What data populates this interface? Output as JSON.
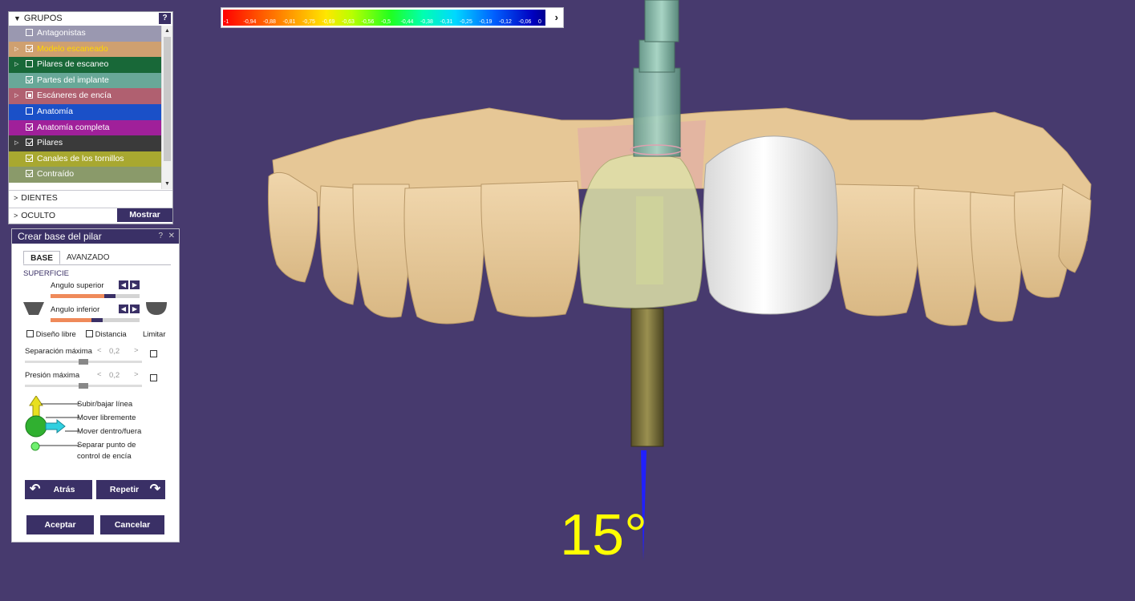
{
  "groups_panel": {
    "title": "GRUPOS",
    "help": "?",
    "items": [
      {
        "label": "Antagonistas",
        "checked": false,
        "expand": false,
        "color": "#9a98b0",
        "text_color": "#ffffff"
      },
      {
        "label": "Modelo escaneado",
        "checked": true,
        "expand": true,
        "color": "#cfa070",
        "text_color": "#ffd700"
      },
      {
        "label": "Pilares de escaneo",
        "checked": false,
        "expand": true,
        "color": "#186838",
        "text_color": "#ffffff"
      },
      {
        "label": "Partes del implante",
        "checked": true,
        "expand": false,
        "color": "#68a898",
        "text_color": "#ffffff"
      },
      {
        "label": "Escáneres de encía",
        "checked": "partial",
        "expand": true,
        "color": "#b06070",
        "text_color": "#ffffff"
      },
      {
        "label": "Anatomía",
        "checked": false,
        "expand": false,
        "color": "#1a50c8",
        "text_color": "#ffffff"
      },
      {
        "label": "Anatomía completa",
        "checked": true,
        "expand": false,
        "color": "#a0209a",
        "text_color": "#ffffff"
      },
      {
        "label": "Pilares",
        "checked": true,
        "expand": true,
        "color": "#3a3a3a",
        "text_color": "#ffffff"
      },
      {
        "label": "Canales de los tornillos",
        "checked": true,
        "expand": false,
        "color": "#a8a830",
        "text_color": "#ffffff"
      },
      {
        "label": "Contraído",
        "checked": true,
        "expand": false,
        "color": "#8a9a6a",
        "text_color": "#ffffff"
      }
    ],
    "sections": {
      "dientes": "DIENTES",
      "oculto": "OCULTO",
      "mostrar": "Mostrar"
    }
  },
  "base_panel": {
    "title": "Crear base del pilar",
    "help": "?",
    "close": "✕",
    "tabs": [
      "BASE",
      "AVANZADO"
    ],
    "section": "SUPERFICIE",
    "angulo_superior": {
      "label": "Angulo superior",
      "level": 0.6
    },
    "angulo_inferior": {
      "label": "Angulo inferior",
      "level": 0.46
    },
    "diseno_libre": "Diseño libre",
    "distancia": "Distancia",
    "limitar": "Limitar",
    "separacion": {
      "label": "Separación máxima",
      "value": "0,2",
      "level": 0.46
    },
    "presion": {
      "label": "Presión máxima",
      "value": "0,2",
      "level": 0.46
    },
    "legend": {
      "subir": "Subir/bajar línea",
      "mover_libre": "Mover libremente",
      "mover_dentro": "Mover dentro/fuera",
      "separar_1": "Separar punto de",
      "separar_2": "control de encía"
    },
    "buttons": {
      "atras": "Atrás",
      "repetir": "Repetir",
      "aceptar": "Aceptar",
      "cancelar": "Cancelar"
    }
  },
  "color_scale": {
    "ticks": [
      "-1",
      "-0,94",
      "-0,88",
      "-0,81",
      "-0,75",
      "-0,69",
      "-0,63",
      "-0,56",
      "-0,5",
      "-0,44",
      "-0,38",
      "-0,31",
      "-0,25",
      "-0,19",
      "-0,12",
      "-0,06",
      "0"
    ],
    "next": "›"
  },
  "viewport": {
    "angle": "15°",
    "colors": {
      "background": "#473a6e",
      "gum": "#e3c59a",
      "crown": "#eeeeee",
      "implant": "#7a7038"
    }
  }
}
